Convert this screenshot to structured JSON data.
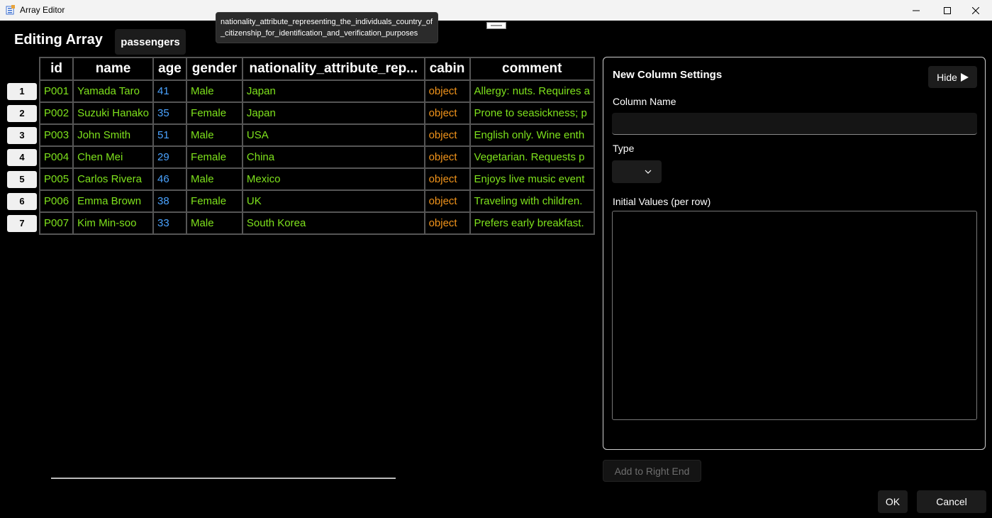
{
  "window": {
    "title": "Array Editor"
  },
  "editor": {
    "heading": "Editing Array",
    "array_name": "passengers"
  },
  "tooltip": {
    "text": "nationality_attribute_representing_the_individuals_country_of_citizenship_for_identification_and_verification_purposes"
  },
  "table": {
    "columns": [
      "id",
      "name",
      "age",
      "gender",
      "nationality_attribute_rep...",
      "cabin",
      "comment"
    ],
    "rows": [
      {
        "num": "1",
        "id": "P001",
        "name": "Yamada Taro",
        "age": "41",
        "gender": "Male",
        "nationality": "Japan",
        "cabin": "object",
        "comment": "Allergy: nuts. Requires a"
      },
      {
        "num": "2",
        "id": "P002",
        "name": "Suzuki Hanako",
        "age": "35",
        "gender": "Female",
        "nationality": "Japan",
        "cabin": "object",
        "comment": "Prone to seasickness; p"
      },
      {
        "num": "3",
        "id": "P003",
        "name": "John Smith",
        "age": "51",
        "gender": "Male",
        "nationality": "USA",
        "cabin": "object",
        "comment": "English only. Wine enth"
      },
      {
        "num": "4",
        "id": "P004",
        "name": "Chen Mei",
        "age": "29",
        "gender": "Female",
        "nationality": "China",
        "cabin": "object",
        "comment": "Vegetarian. Requests p"
      },
      {
        "num": "5",
        "id": "P005",
        "name": "Carlos Rivera",
        "age": "46",
        "gender": "Male",
        "nationality": "Mexico",
        "cabin": "object",
        "comment": "Enjoys live music event"
      },
      {
        "num": "6",
        "id": "P006",
        "name": "Emma Brown",
        "age": "38",
        "gender": "Female",
        "nationality": "UK",
        "cabin": "object",
        "comment": "Traveling with children."
      },
      {
        "num": "7",
        "id": "P007",
        "name": "Kim Min-soo",
        "age": "33",
        "gender": "Male",
        "nationality": "South Korea",
        "cabin": "object",
        "comment": "Prefers early breakfast."
      }
    ]
  },
  "panel": {
    "title": "New Column Settings",
    "hide_label": "Hide",
    "column_name_label": "Column Name",
    "column_name_value": "",
    "type_label": "Type",
    "type_value": "",
    "initial_values_label": "Initial Values (per row)",
    "initial_values_value": ""
  },
  "actions": {
    "add_label": "Add to Right End",
    "ok_label": "OK",
    "cancel_label": "Cancel"
  },
  "colors": {
    "text_green": "#7ee21c",
    "number_blue": "#4aa3ff",
    "object_orange": "#f0931a"
  },
  "icons": {
    "app": "array-editor-app-icon",
    "hide": "triangle-right-icon",
    "dropdown": "chevron-down-icon"
  }
}
